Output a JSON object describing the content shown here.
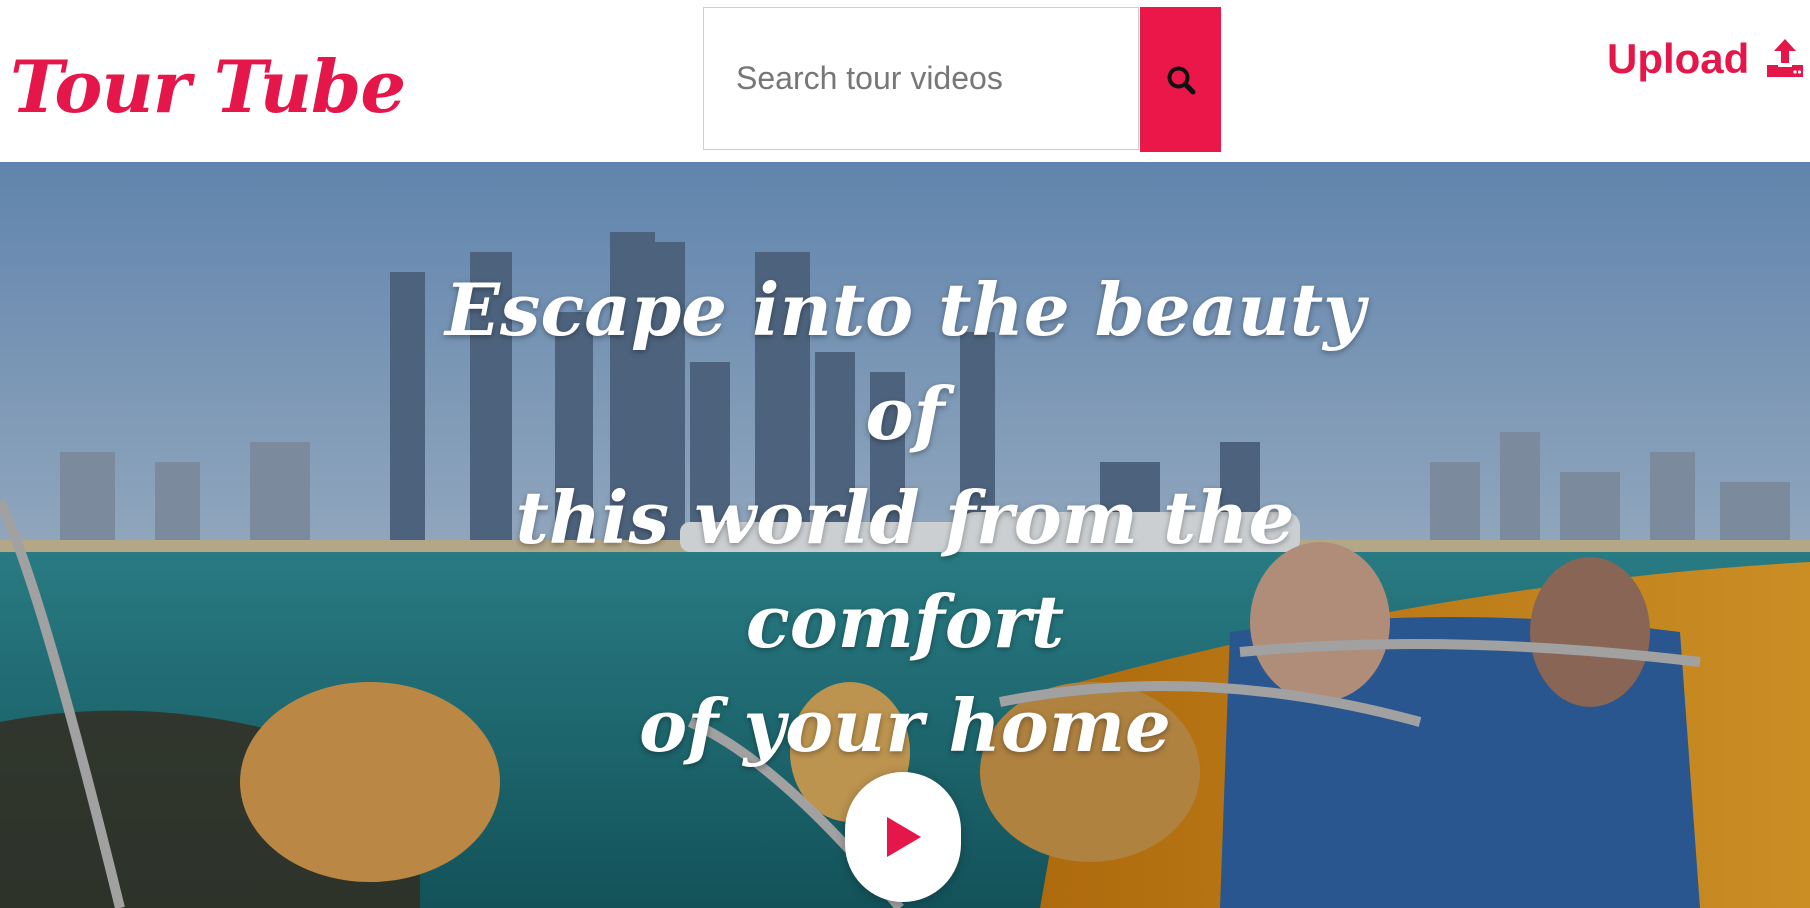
{
  "header": {
    "logo_text": "Tour Tube",
    "search": {
      "placeholder": "Search tour videos",
      "value": "",
      "button_icon": "search-icon"
    },
    "upload": {
      "label": "Upload",
      "icon": "upload-icon"
    }
  },
  "hero": {
    "title_lines": [
      "Escape into the beauty of",
      "this world from the comfort",
      "of your home"
    ],
    "play_icon": "play-icon"
  },
  "colors": {
    "brand": "#e5174a",
    "search_button": "#eb1748",
    "hero_text": "#ffffff",
    "play_button_bg": "#ffffff",
    "play_triangle": "#e5174a"
  }
}
